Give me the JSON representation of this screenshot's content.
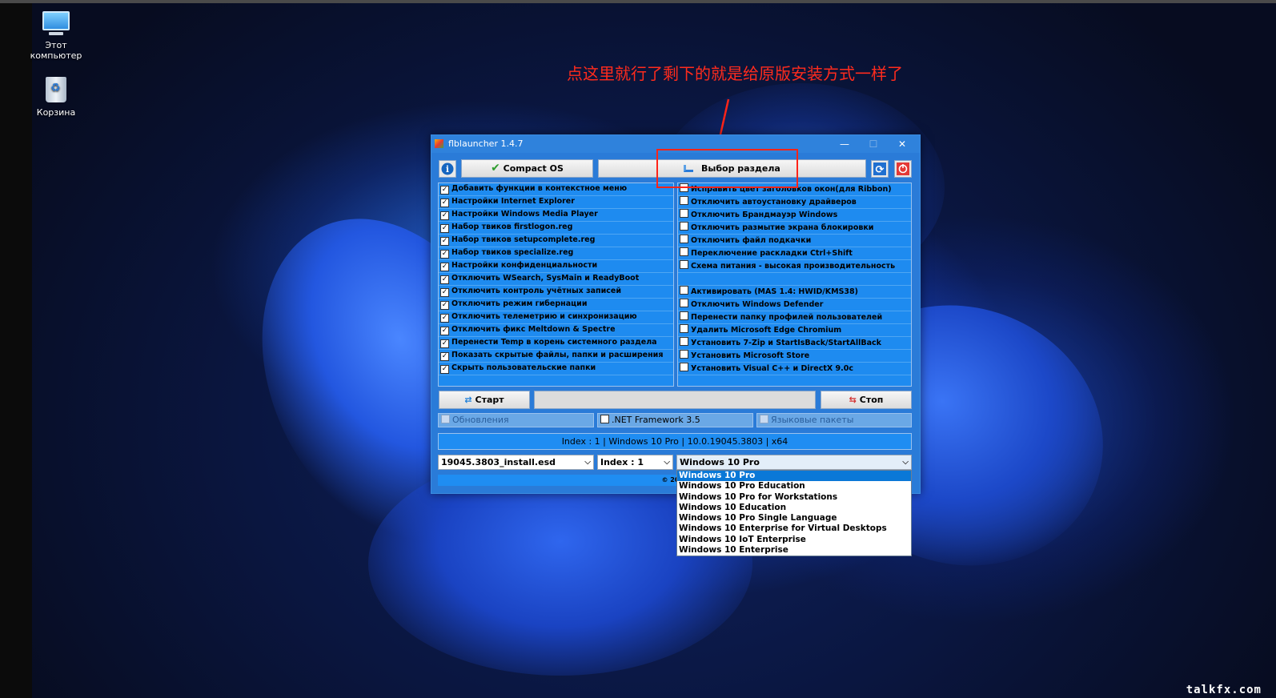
{
  "desktop": {
    "icons": [
      {
        "label": "Этот\nкомпьютер",
        "icon": "this-pc-icon"
      },
      {
        "label": "Корзина",
        "icon": "recycle-bin-icon"
      }
    ],
    "annotation": "点这里就行了剩下的就是给原版安装方式一样了",
    "watermark": "talkfx.com"
  },
  "window": {
    "title": "flblauncher 1.4.7",
    "controls": {
      "minimize": "—",
      "maximize": "☐",
      "close": "✕"
    },
    "toolbar": {
      "compact_label": "Compact OS",
      "partition_label": "Выбор раздела"
    },
    "left_options": [
      {
        "label": "Добавить функции в контекстное меню",
        "checked": true
      },
      {
        "label": "Настройки Internet Explorer",
        "checked": true
      },
      {
        "label": "Настройки Windows Media Player",
        "checked": true
      },
      {
        "label": "Набор твиков firstlogon.reg",
        "checked": true
      },
      {
        "label": "Набор твиков setupcomplete.reg",
        "checked": true
      },
      {
        "label": "Набор твиков specialize.reg",
        "checked": true
      },
      {
        "label": "Настройки конфиденциальности",
        "checked": true
      },
      {
        "label": "Отключить WSearch, SysMain и ReadyBoot",
        "checked": true
      },
      {
        "label": "Отключить контроль учётных записей",
        "checked": true
      },
      {
        "label": "Отключить режим гибернации",
        "checked": true
      },
      {
        "label": "Отключить телеметрию и синхронизацию",
        "checked": true
      },
      {
        "label": "Отключить фикс Meltdown & Spectre",
        "checked": true
      },
      {
        "label": "Перенести Temp в корень системного раздела",
        "checked": true
      },
      {
        "label": "Показать скрытые файлы, папки и расширения",
        "checked": true
      },
      {
        "label": "Скрыть пользовательские папки",
        "checked": true
      }
    ],
    "right_options": [
      {
        "label": "Исправить цвет заголовков окон(для Ribbon)",
        "checked": false
      },
      {
        "label": "Отключить автоустановку драйверов",
        "checked": false
      },
      {
        "label": "Отключить Брандмауэр Windows",
        "checked": false
      },
      {
        "label": "Отключить размытие экрана блокировки",
        "checked": false
      },
      {
        "label": "Отключить файл подкачки",
        "checked": false
      },
      {
        "label": "Переключение раскладки Ctrl+Shift",
        "checked": false
      },
      {
        "label": "Схема питания - высокая производительность",
        "checked": false
      },
      {
        "label": "",
        "checked": null
      },
      {
        "label": "Активировать (MAS 1.4: HWID/KMS38)",
        "checked": false
      },
      {
        "label": "Отключить Windows Defender",
        "checked": false
      },
      {
        "label": "Перенести папку профилей пользователей",
        "checked": false
      },
      {
        "label": "Удалить Microsoft Edge Chromium",
        "checked": false
      },
      {
        "label": "Установить 7-Zip и StartIsBack/StartAllBack",
        "checked": false
      },
      {
        "label": "Установить Microsoft Store",
        "checked": false
      },
      {
        "label": "Установить Visual C++ и DirectX 9.0c",
        "checked": false
      }
    ],
    "start_label": "Старт",
    "stop_label": "Стоп",
    "progress_text": "",
    "updates_label": "Обновления",
    "netfx_label": ".NET Framework 3.5",
    "langpacks_label": "Языковые пакеты",
    "info_text": "Index : 1 | Windows 10 Pro | 10.0.19045.3803 | x64",
    "combos": {
      "file": "19045.3803_install.esd",
      "index": "Index : 1",
      "edition": "Windows 10 Pro"
    },
    "footer_text": "© 2021"
  },
  "edition_dropdown": {
    "selected_index": 0,
    "items": [
      "Windows 10 Pro",
      "Windows 10 Pro Education",
      "Windows 10 Pro for Workstations",
      "Windows 10 Education",
      "Windows 10 Pro Single Language",
      "Windows 10 Enterprise for Virtual Desktops",
      "Windows 10 IoT Enterprise",
      "Windows 10 Enterprise"
    ]
  }
}
